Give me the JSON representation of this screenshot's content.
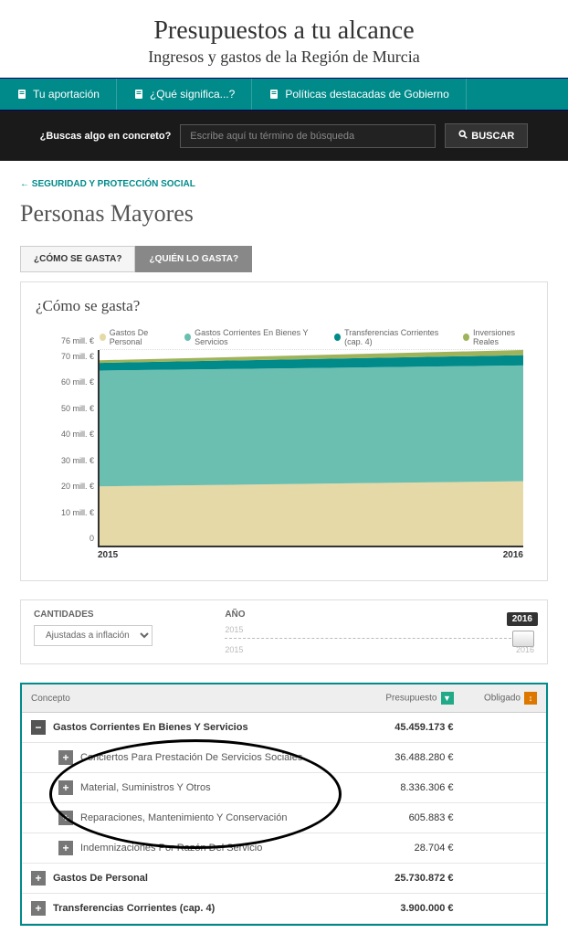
{
  "header": {
    "title": "Presupuestos a tu alcance",
    "subtitle": "Ingresos y gastos de la Región de Murcia"
  },
  "nav": {
    "items": [
      {
        "label": "Tu aportación"
      },
      {
        "label": "¿Qué significa...?"
      },
      {
        "label": "Políticas destacadas de Gobierno"
      }
    ]
  },
  "search": {
    "prompt": "¿Buscas algo en concreto?",
    "placeholder": "Escribe aquí tu término de búsqueda",
    "button": "BUSCAR"
  },
  "breadcrumb": "SEGURIDAD Y PROTECCIÓN SOCIAL",
  "page_title": "Personas Mayores",
  "tabs": {
    "how": "¿CÓMO SE GASTA?",
    "who": "¿QUIÉN LO GASTA?"
  },
  "panel_title": "¿Cómo se gasta?",
  "chart_data": {
    "type": "area",
    "x": [
      "2015",
      "2016"
    ],
    "xlabel": "",
    "ylabel": "",
    "ylim": [
      0,
      76
    ],
    "yticks": [
      "0",
      "10 mill. €",
      "20 mill. €",
      "30 mill. €",
      "40 mill. €",
      "50 mill. €",
      "60 mill. €",
      "70 mill. €",
      "76 mill. €"
    ],
    "series": [
      {
        "name": "Gastos De Personal",
        "values": [
          23,
          25
        ],
        "color": "#e6d9a8"
      },
      {
        "name": "Gastos Corrientes En Bienes Y Servicios",
        "values": [
          45,
          45
        ],
        "color": "#6bbfb0"
      },
      {
        "name": "Transferencias Corrientes (cap. 4)",
        "values": [
          3,
          4
        ],
        "color": "#008a8a"
      },
      {
        "name": "Inversiones Reales",
        "values": [
          1,
          2
        ],
        "color": "#9fb35a"
      }
    ]
  },
  "controls": {
    "cantidades_label": "CANTIDADES",
    "cantidades_value": "Ajustadas a inflación",
    "ano_label": "AÑO",
    "year_start": "2015",
    "year_end": "2016",
    "year_selected": "2016"
  },
  "table": {
    "headers": {
      "concepto": "Concepto",
      "presupuesto": "Presupuesto",
      "obligado": "Obligado"
    },
    "rows": [
      {
        "level": 0,
        "expanded": true,
        "label": "Gastos Corrientes En Bienes Y Servicios",
        "presupuesto": "45.459.173 €",
        "obligado": ""
      },
      {
        "level": 1,
        "expanded": false,
        "label": "Conciertos Para Prestación De Servicios Sociales",
        "presupuesto": "36.488.280 €",
        "obligado": ""
      },
      {
        "level": 1,
        "expanded": false,
        "label": "Material, Suministros Y Otros",
        "presupuesto": "8.336.306 €",
        "obligado": ""
      },
      {
        "level": 1,
        "expanded": false,
        "label": "Reparaciones, Mantenimiento Y Conservación",
        "presupuesto": "605.883 €",
        "obligado": ""
      },
      {
        "level": 1,
        "expanded": false,
        "label": "Indemnizaciones Por Razón Del Servicio",
        "presupuesto": "28.704 €",
        "obligado": ""
      },
      {
        "level": 0,
        "expanded": false,
        "label": "Gastos De Personal",
        "presupuesto": "25.730.872 €",
        "obligado": ""
      },
      {
        "level": 0,
        "expanded": false,
        "label": "Transferencias Corrientes (cap. 4)",
        "presupuesto": "3.900.000 €",
        "obligado": ""
      }
    ]
  }
}
